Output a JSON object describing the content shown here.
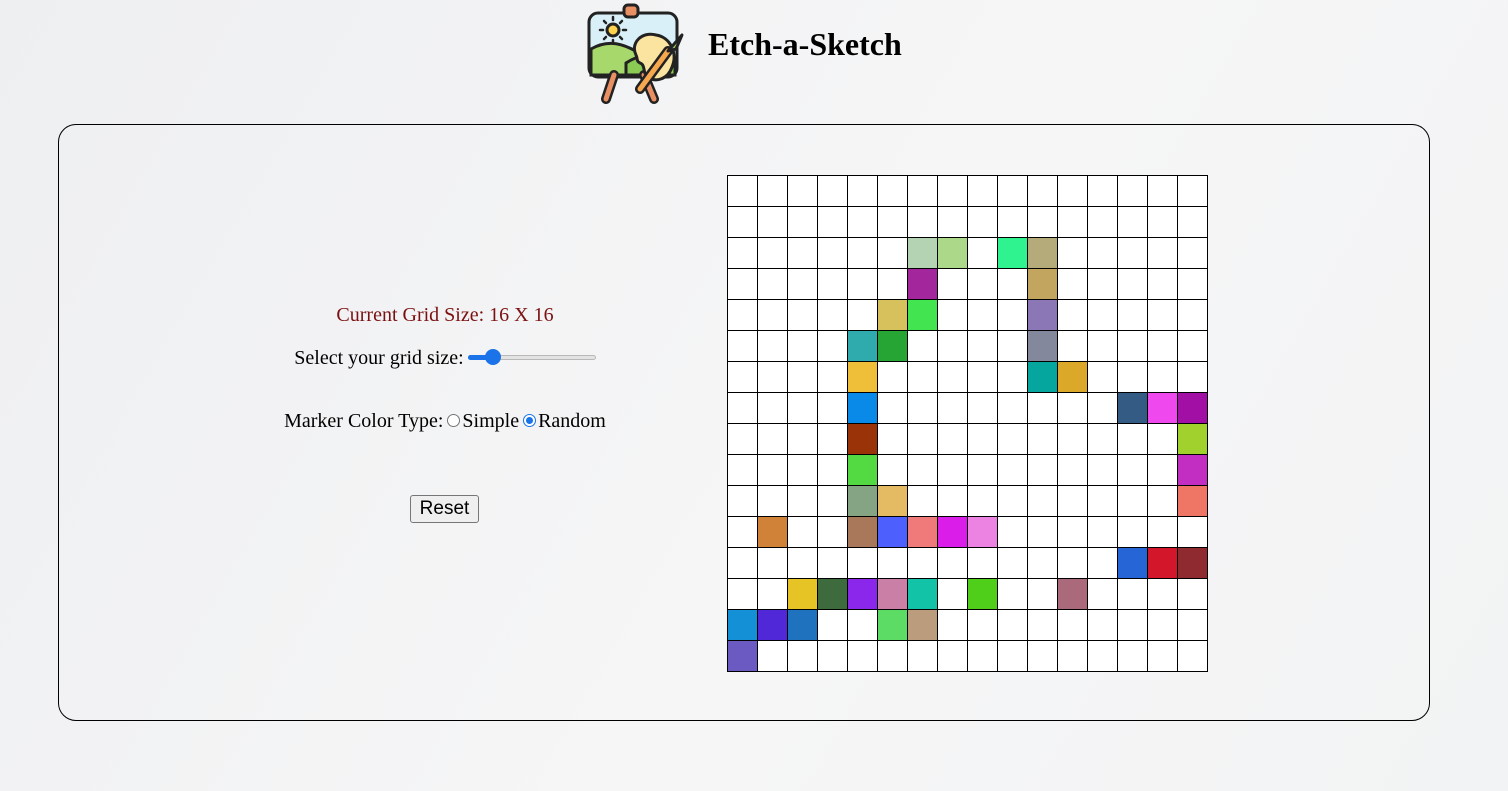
{
  "header": {
    "title": "Etch-a-Sketch",
    "logo_icon": "painting-easel-logo-icon"
  },
  "controls": {
    "grid_size_text": "Current Grid Size: 16 X 16",
    "slider_label": "Select your grid size:",
    "slider_value": 16,
    "slider_min": 1,
    "slider_max": 100,
    "color_type_label": "Marker Color Type:",
    "options": [
      "Simple",
      "Random"
    ],
    "selected_option": "Random",
    "reset_label": "Reset"
  },
  "grid": {
    "rows": 16,
    "cols": 16,
    "default_color": "#ffffff",
    "colored_cells": [
      {
        "row": 2,
        "col": 6,
        "color": "#b3d3b3"
      },
      {
        "row": 2,
        "col": 7,
        "color": "#acd88a"
      },
      {
        "row": 2,
        "col": 9,
        "color": "#2ef38e"
      },
      {
        "row": 2,
        "col": 10,
        "color": "#b4aa7a"
      },
      {
        "row": 3,
        "col": 6,
        "color": "#a3269d"
      },
      {
        "row": 3,
        "col": 10,
        "color": "#c2a55f"
      },
      {
        "row": 4,
        "col": 5,
        "color": "#d6c15c"
      },
      {
        "row": 4,
        "col": 6,
        "color": "#42e44f"
      },
      {
        "row": 4,
        "col": 10,
        "color": "#8b77b5"
      },
      {
        "row": 5,
        "col": 4,
        "color": "#2fabad"
      },
      {
        "row": 5,
        "col": 5,
        "color": "#27a534"
      },
      {
        "row": 5,
        "col": 10,
        "color": "#83889c"
      },
      {
        "row": 6,
        "col": 4,
        "color": "#f0bf3a"
      },
      {
        "row": 6,
        "col": 10,
        "color": "#05a69e"
      },
      {
        "row": 6,
        "col": 11,
        "color": "#dca82a"
      },
      {
        "row": 7,
        "col": 4,
        "color": "#0a8ae8"
      },
      {
        "row": 7,
        "col": 13,
        "color": "#345b83"
      },
      {
        "row": 7,
        "col": 14,
        "color": "#ee48ee"
      },
      {
        "row": 7,
        "col": 15,
        "color": "#a10fa4"
      },
      {
        "row": 8,
        "col": 4,
        "color": "#9b3309"
      },
      {
        "row": 8,
        "col": 15,
        "color": "#a1d12d"
      },
      {
        "row": 9,
        "col": 4,
        "color": "#53da42"
      },
      {
        "row": 9,
        "col": 15,
        "color": "#c12ec1"
      },
      {
        "row": 10,
        "col": 4,
        "color": "#84a484"
      },
      {
        "row": 10,
        "col": 5,
        "color": "#e4ba62"
      },
      {
        "row": 10,
        "col": 15,
        "color": "#ef7665"
      },
      {
        "row": 11,
        "col": 1,
        "color": "#cf8238"
      },
      {
        "row": 11,
        "col": 4,
        "color": "#a9785b"
      },
      {
        "row": 11,
        "col": 5,
        "color": "#4d5ffc"
      },
      {
        "row": 11,
        "col": 6,
        "color": "#f07a7a"
      },
      {
        "row": 11,
        "col": 7,
        "color": "#da1de9"
      },
      {
        "row": 11,
        "col": 8,
        "color": "#ec83e3"
      },
      {
        "row": 12,
        "col": 13,
        "color": "#2665d5"
      },
      {
        "row": 12,
        "col": 14,
        "color": "#d4162a"
      },
      {
        "row": 12,
        "col": 15,
        "color": "#8f2a30"
      },
      {
        "row": 13,
        "col": 2,
        "color": "#e7c425"
      },
      {
        "row": 13,
        "col": 3,
        "color": "#3e6b3e"
      },
      {
        "row": 13,
        "col": 4,
        "color": "#8a27ea"
      },
      {
        "row": 13,
        "col": 5,
        "color": "#ca80a6"
      },
      {
        "row": 13,
        "col": 6,
        "color": "#12c3a8"
      },
      {
        "row": 13,
        "col": 8,
        "color": "#4fcf1a"
      },
      {
        "row": 13,
        "col": 11,
        "color": "#ab6a7c"
      },
      {
        "row": 14,
        "col": 0,
        "color": "#1490d6"
      },
      {
        "row": 14,
        "col": 1,
        "color": "#5128d8"
      },
      {
        "row": 14,
        "col": 2,
        "color": "#1f72bd"
      },
      {
        "row": 14,
        "col": 5,
        "color": "#5ddc65"
      },
      {
        "row": 14,
        "col": 6,
        "color": "#bb9c7c"
      },
      {
        "row": 15,
        "col": 0,
        "color": "#6a5ac2"
      }
    ]
  },
  "colors": {
    "grid_size_text": "#7b1010",
    "accent": "#1a73e8"
  }
}
